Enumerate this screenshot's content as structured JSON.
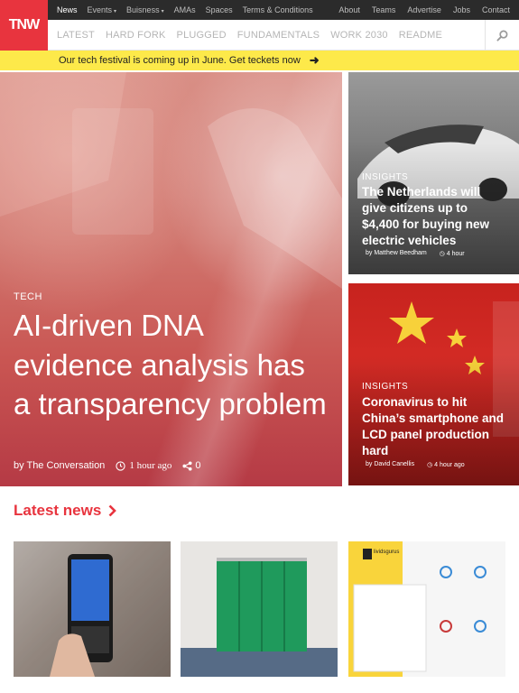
{
  "logo": {
    "text": "TNW",
    "color": "#e8343e"
  },
  "topbar": {
    "left": [
      {
        "label": "News",
        "active": true
      },
      {
        "label": "Events",
        "caret": "▾"
      },
      {
        "label": "Buisness",
        "caret": "▾"
      },
      {
        "label": "AMAs"
      },
      {
        "label": "Spaces"
      },
      {
        "label": "Terms & Conditions"
      }
    ],
    "right": [
      "About",
      "Teams",
      "Advertise",
      "Jobs",
      "Contact"
    ]
  },
  "nav": {
    "categories": [
      "LATEST",
      "HARD FORK",
      "PLUGGED",
      "FUNDAMENTALS",
      "WORK 2030",
      "README"
    ],
    "search_icon": "search-icon"
  },
  "banner": {
    "text": "Our tech festival is coming up in June. Get teckets now",
    "arrow": "➜",
    "color": "#fde94a"
  },
  "hero": {
    "category": "TECH",
    "title": "AI-driven DNA evidence analysis has a transparency problem",
    "author": "by The Conversation",
    "time": "1 hour ago",
    "shares": "0"
  },
  "side_cards": [
    {
      "category": "INSIGHTS",
      "title": "The Netherlands will give citizens up to $4,400 for buying new electric vehicles",
      "author": "by Matthew Beedham",
      "time": "4 hour"
    },
    {
      "category": "INSIGHTS",
      "title": "Coronavirus to hit China’s smartphone and LCD panel production hard",
      "author": "by David Canellis",
      "time": "4 hour ago"
    }
  ],
  "latest": {
    "label": "Latest news",
    "chevron": "›"
  },
  "thumb3": {
    "brand": "lividsgurus"
  }
}
